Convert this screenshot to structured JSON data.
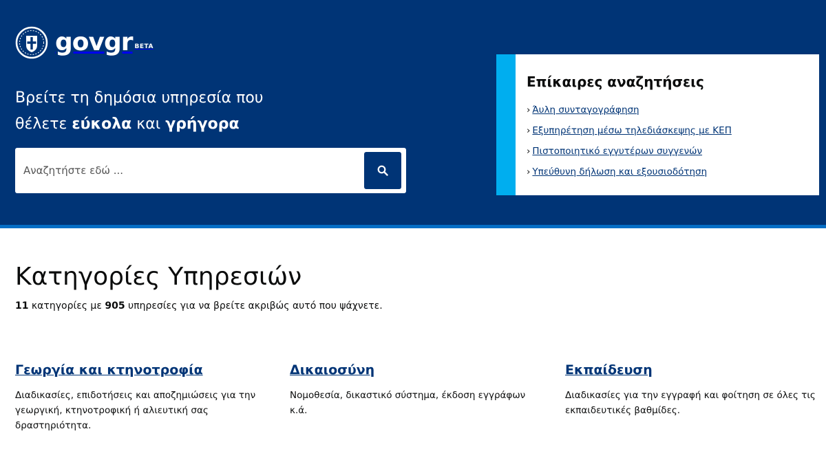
{
  "header": {
    "logo_text_gov": "gov",
    "logo_text_gr": "gr",
    "logo_badge": "BETA",
    "headline_line1": "Βρείτε τη δημόσια υπηρεσία που",
    "headline_pre": "θέλετε ",
    "headline_bold1": "εύκολα",
    "headline_mid": " και ",
    "headline_bold2": "γρήγορα"
  },
  "search": {
    "placeholder": "Αναζητήστε εδώ ...",
    "button_icon": "search-icon"
  },
  "trending": {
    "title": "Επίκαιρες αναζητήσεις",
    "chevron": "›",
    "items": [
      "Άυλη συνταγογράφηση",
      "Εξυπηρέτηση μέσω τηλεδιάσκεψης με ΚΕΠ",
      "Πιστοποιητικό εγγυτέρων συγγενών",
      "Υπεύθυνη δήλωση και εξουσιοδότηση"
    ]
  },
  "categories": {
    "title": "Κατηγορίες Υπηρεσιών",
    "count_categories": "11",
    "text_a": " κατηγορίες με ",
    "count_services": "905",
    "text_b": " υπηρεσίες για να βρείτε ακριβώς αυτό που ψάχνετε.",
    "items": [
      {
        "name": "Γεωργία και κτηνοτροφία",
        "description": "Διαδικασίες, επιδοτήσεις και αποζημιώσεις για την γεωργική, κτηνοτροφική ή αλιευτική σας δραστηριότητα."
      },
      {
        "name": "Δικαιοσύνη",
        "description": "Νομοθεσία, δικαστικό σύστημα, έκδοση εγγράφων κ.ά."
      },
      {
        "name": "Εκπαίδευση",
        "description": "Διαδικασίες για την εγγραφή και φοίτηση σε όλες τις εκπαιδευτικές βαθμίδες."
      }
    ]
  },
  "colors": {
    "primary_navy": "#003476",
    "accent_cyan": "#00aeef",
    "accent_blue_border": "#046ec5"
  }
}
